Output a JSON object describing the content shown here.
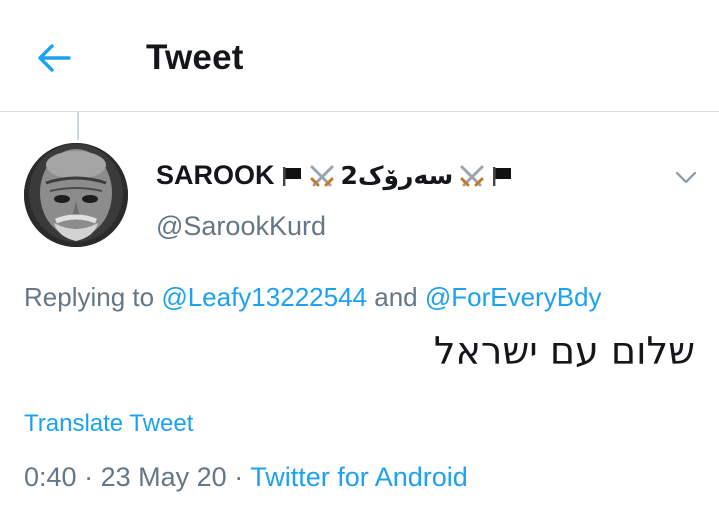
{
  "header": {
    "title": "Tweet"
  },
  "tweet": {
    "author": {
      "display_name": "SAROOK",
      "name_suffix": "2سەرۆک",
      "handle": "@SarookKurd"
    },
    "replying_to": {
      "prefix": "Replying to",
      "connector": "and",
      "mentions": [
        "@Leafy13222544",
        "@ForEveryBdy"
      ]
    },
    "text": "שלום עם ישראל",
    "translate_label": "Translate Tweet",
    "meta": {
      "time": "0:40",
      "separator": "·",
      "date": "23 May 20",
      "source": "Twitter for Android"
    }
  },
  "colors": {
    "accent": "#1da1f2",
    "text_primary": "#14171a",
    "text_secondary": "#657786",
    "divider": "#d8dee3"
  },
  "icons": {
    "back": "arrow-left-icon",
    "flag": "black-flag-icon",
    "swords": "crossed-swords-icon",
    "more": "chevron-down-icon"
  }
}
